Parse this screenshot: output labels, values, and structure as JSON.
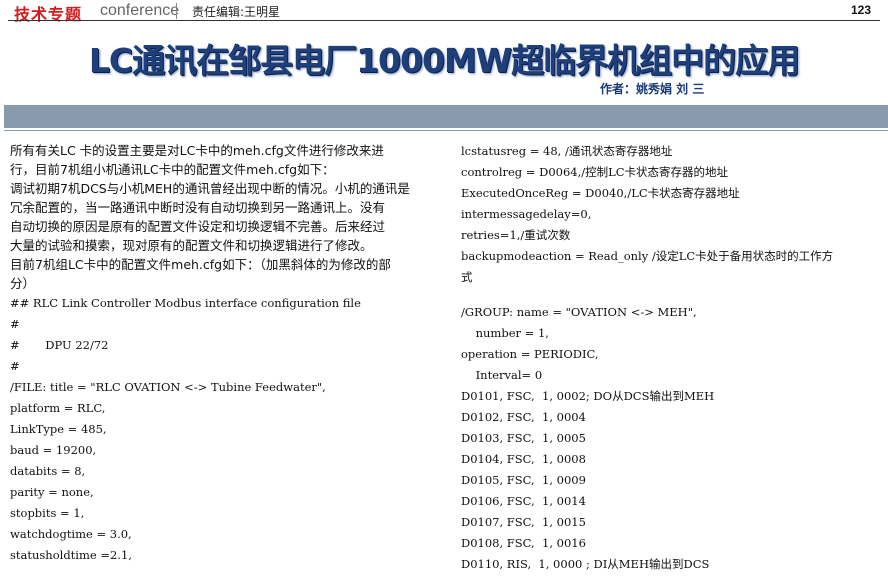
{
  "header": {
    "section_tag": "技术专题",
    "conference_word": "conference",
    "editor": "责任编辑:王明星",
    "page_number": "123"
  },
  "article": {
    "title": "LC通讯在邹县电厂1000MW超临界机组中的应用",
    "authors": "作者：姚秀娟  刘  三"
  },
  "left_column": {
    "intro": [
      "所有有关LC 卡的设置主要是对LC卡中的meh.cfg文件进行修改来进",
      "行，目前7机组小机通讯LC卡中的配置文件meh.cfg如下：",
      "调试初期7机DCS与小机MEH的通讯曾经出现中断的情况。小机的通讯是",
      "冗余配置的，当一路通讯中断时没有自动切换到另一路通讯上。没有",
      "自动切换的原因是原有的配置文件设定和切换逻辑不完善。后来经过",
      "大量的试验和摸索，现对原有的配置文件和切换逻辑进行了修改。",
      "目前7机组LC卡中的配置文件meh.cfg如下：（加黑斜体的为修改的部",
      "分）"
    ],
    "code_lines": [
      "## RLC Link Controller Modbus interface configuration file",
      "#",
      "#       DPU 22/72",
      "#",
      "/FILE: title = \"RLC OVATION <-> Tubine Feedwater\",",
      "platform = RLC,",
      "LinkType = 485,",
      "baud = 19200,",
      "databits = 8,",
      "parity = none,",
      "stopbits = 1,",
      "watchdogtime = 3.0,",
      "statusholdtime =2.1,"
    ]
  },
  "right_column": {
    "lines_top": [
      "lcstatusreg = 48, /通讯状态寄存器地址",
      "controlreg = D0064,/控制LC卡状态寄存器的地址",
      "ExecutedOnceReg = D0040,/LC卡状态寄存器地址",
      "intermessagedelay=0,",
      "retries=1,/重试次数",
      "backupmodeaction = Read_only /设定LC卡处于备用状态时的工作方",
      "式"
    ],
    "lines_bottom": [
      "/GROUP: name = \"OVATION <-> MEH\",",
      "    number = 1,",
      "operation = PERIODIC,",
      "    Interval= 0",
      "D0101, FSC,  1, 0002; DO从DCS输出到MEH",
      "D0102, FSC,  1, 0004",
      "D0103, FSC,  1, 0005",
      "D0104, FSC,  1, 0008",
      "D0105, FSC,  1, 0009",
      "D0106, FSC,  1, 0014",
      "D0107, FSC,  1, 0015",
      "D0108, FSC,  1, 0016",
      "D0110, RIS,  1, 0000 ; DI从MEH输出到DCS"
    ]
  },
  "colors": {
    "tag_red": "#d7191c",
    "title_blue": "#1e3f7a",
    "band_gray": "#8a9aae"
  }
}
